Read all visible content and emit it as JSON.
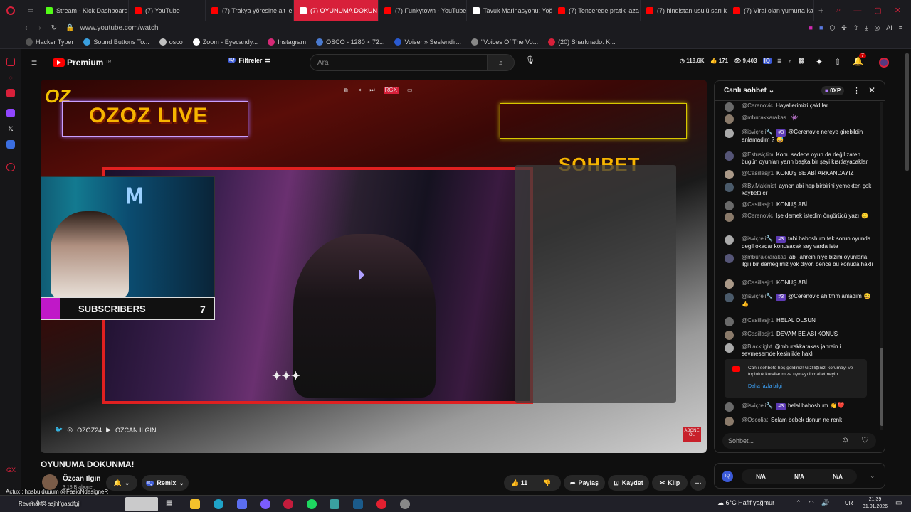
{
  "browser": {
    "tabs": [
      {
        "label": "Stream - Kick Dashboard",
        "color": "#53fc18"
      },
      {
        "label": "(7) YouTube",
        "color": "#ff0000"
      },
      {
        "label": "(7) Trakya yöresine ait le",
        "color": "#ff0000"
      },
      {
        "label": "(7) OYUNUMA DOKUN",
        "color": "#ffffff",
        "active": true
      },
      {
        "label": "(7) Funkytown - YouTube",
        "color": "#ff0000"
      },
      {
        "label": "Tavuk Marinasyonu: Yoğ",
        "color": "#ffffff"
      },
      {
        "label": "(7) Tencerede pratik laza",
        "color": "#ff0000"
      },
      {
        "label": "(7) hindistan usulü sarı k",
        "color": "#ff0000"
      },
      {
        "label": "(7) Viral olan yumurta kay",
        "color": "#ff0000"
      }
    ],
    "url": "www.youtube.com/watch",
    "bookmarks": [
      "Hacker Typer",
      "Sound Buttons To...",
      "osco",
      "Zoom - Eyecandy...",
      "Instagram",
      "OSCO - 1280 × 72...",
      "Voiser » Seslendir...",
      "\"Voices Of The Vo...",
      "(20) Sharknado: K..."
    ]
  },
  "youtube": {
    "logo": "Premium",
    "logo_sup": "TR",
    "filters_label": "Filtreler",
    "search_placeholder": "Ara",
    "stats": {
      "views": "118.6K",
      "likes": "171",
      "viewers": "9,403"
    },
    "notif_count": "7"
  },
  "video": {
    "overlay_title": "OZOZ LIVE",
    "overlay_chat_title": "SOHBET",
    "subs_left": "2",
    "subs_label": "SUBSCRIBERS",
    "subs_right": "7",
    "social_handle_1": "OZOZ24",
    "social_handle_2": "ÖZCAN ILGIN",
    "corner_label": "ABONE OL"
  },
  "below": {
    "title": "OYUNUMA DOKUNMA!",
    "channel": "Özcan Ilgın",
    "subscribers": "3,18 B abone",
    "remix": "Remix",
    "likes": "11",
    "share": "Paylaş",
    "save": "Kaydet",
    "clip": "Klip"
  },
  "chat": {
    "header": "Canlı sohbet",
    "xp": "0XP",
    "messages": [
      {
        "author": "@Cerenovic",
        "text": "Hayallerimizi çaldılar",
        "badge": "",
        "emoji": ""
      },
      {
        "author": "@mburakkarakas",
        "text": "",
        "badge": "",
        "emoji": "👾"
      },
      {
        "author": "@isviçreli🔧",
        "text": "@Cerenovic nereye girebildin anlamadım ?",
        "badge": "#3",
        "emoji": "😅"
      },
      {
        "author": "@Estusiçtim",
        "text": "Konu sadece oyun da değil zaten bugün oyunları yarın başka bir şeyi kısıtlayacaklar",
        "badge": "",
        "emoji": ""
      },
      {
        "author": "@Casillasjr1",
        "text": "KONUŞ BE ABİ ARKANDAYIZ",
        "badge": "",
        "emoji": ""
      },
      {
        "author": "@By.Makinist",
        "text": "aynen abi hep birbirini yemekten çok kaybettiler",
        "badge": "",
        "emoji": ""
      },
      {
        "author": "@Casillasjr1",
        "text": "KONUŞ ABİ",
        "badge": "",
        "emoji": ""
      },
      {
        "author": "@Cerenovic",
        "text": "İşe demek istedim öngörücü yazı",
        "badge": "",
        "emoji": "🙂"
      },
      {
        "author": "@isviçreli🔧",
        "text": "tabi baboshum tek sorun oyunda degil okadar konusacak sey varda iste",
        "badge": "#3",
        "emoji": ""
      },
      {
        "author": "@mburakkarakas",
        "text": "abi jahrein niye bizim oyunlarla ilgili bir derneğimiz yok diyor. bence bu konuda haklı",
        "badge": "",
        "emoji": ""
      },
      {
        "author": "@Casillasjr1",
        "text": "KONUŞ ABİ",
        "badge": "",
        "emoji": ""
      },
      {
        "author": "@isviçreli🔧",
        "text": "@Cerenovic ah tmm anladım",
        "badge": "#3",
        "emoji": "😄👍"
      },
      {
        "author": "@Casillasjr1",
        "text": "HELAL OLSUN",
        "badge": "",
        "emoji": ""
      },
      {
        "author": "@Casillasjr1",
        "text": "DEVAM BE ABİ KONUŞ",
        "badge": "",
        "emoji": ""
      },
      {
        "author": "@Blacklight",
        "text": "@mburakkarakas jahrein i sevmesemde kesinlikle haklı",
        "badge": "",
        "emoji": ""
      }
    ],
    "welcome": "Canlı sohbete hoş geldiniz! Gizliliğinizi korumayı ve topluluk kurallarımıza uymayı ihmal etmeyin.",
    "welcome_link": "Daha fazla bilgi",
    "after": [
      {
        "author": "@isviçreli🔧",
        "text": "helal baboshum",
        "badge": "#3",
        "emoji": "👏❤️"
      },
      {
        "author": "@Oscoliat",
        "text": "Selam bebek donun ne renk",
        "badge": "",
        "emoji": ""
      }
    ],
    "input_placeholder": "Sohbet...",
    "na": [
      "N/A",
      "N/A",
      "N/A"
    ]
  },
  "overlay_text": {
    "line1": "Actux : hosbulduuum @FasioNdesigneR",
    "line2": "Revenant : asjhlfgasdfgjl"
  },
  "taskbar": {
    "search": "Ara",
    "weather": "6°C  Hafif yağmur",
    "lang": "TUR",
    "time": "21:39",
    "date": "31.01.2026"
  }
}
